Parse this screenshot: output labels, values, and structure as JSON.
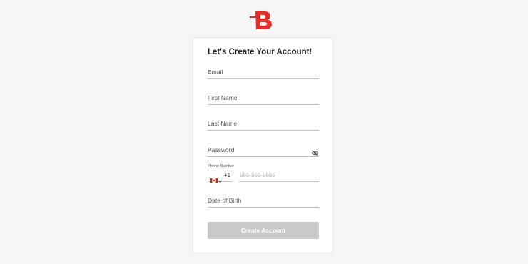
{
  "brand": {
    "logo_icon": "bitbuy-b-logo-icon",
    "accent_color": "#e0302e"
  },
  "form": {
    "title": "Let's Create Your Account!",
    "email_label": "Email",
    "first_name_label": "First Name",
    "last_name_label": "Last Name",
    "password_label": "Password",
    "password_toggle_icon": "eye-slash-icon",
    "phone_label": "Phone Number",
    "country_flag_icon": "canada-flag-icon",
    "dial_code": "+1",
    "phone_placeholder": "555-555-5555",
    "dob_label": "Date of Birth",
    "submit_label": "Create Account",
    "submit_color_disabled": "#c9c9c9"
  }
}
